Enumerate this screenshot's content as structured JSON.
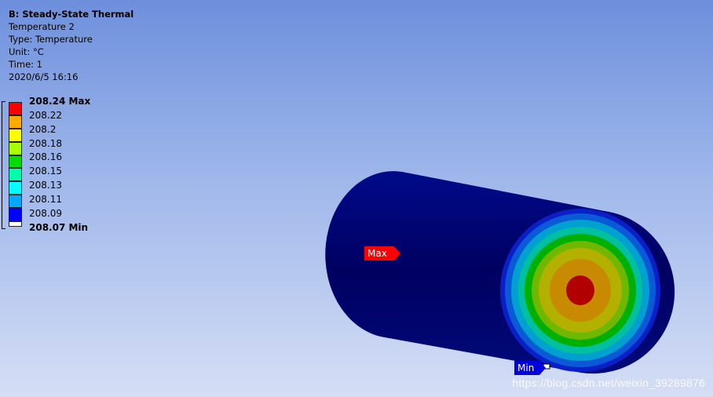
{
  "result_info": {
    "title": "B: Steady-State Thermal",
    "name": "Temperature 2",
    "type": "Type: Temperature",
    "unit": "Unit: °C",
    "time": "Time: 1",
    "datetime": "2020/6/5 16:16"
  },
  "legend": {
    "max_label": "208.24 Max",
    "min_label": "208.07 Min",
    "levels": [
      "208.22",
      "208.2",
      "208.18",
      "208.16",
      "208.15",
      "208.13",
      "208.11",
      "208.09"
    ],
    "colors": [
      "#ff0000",
      "#ffaa00",
      "#ffff00",
      "#aaff00",
      "#00dd00",
      "#00ffaa",
      "#00ffff",
      "#00aaff",
      "#0000ff"
    ]
  },
  "probes": {
    "max_tag": "Max",
    "min_tag": "Min",
    "max_color": "#ff0000",
    "min_color": "#0000e0"
  },
  "watermark": "https://blog.csdn.net/weixin_39289876"
}
